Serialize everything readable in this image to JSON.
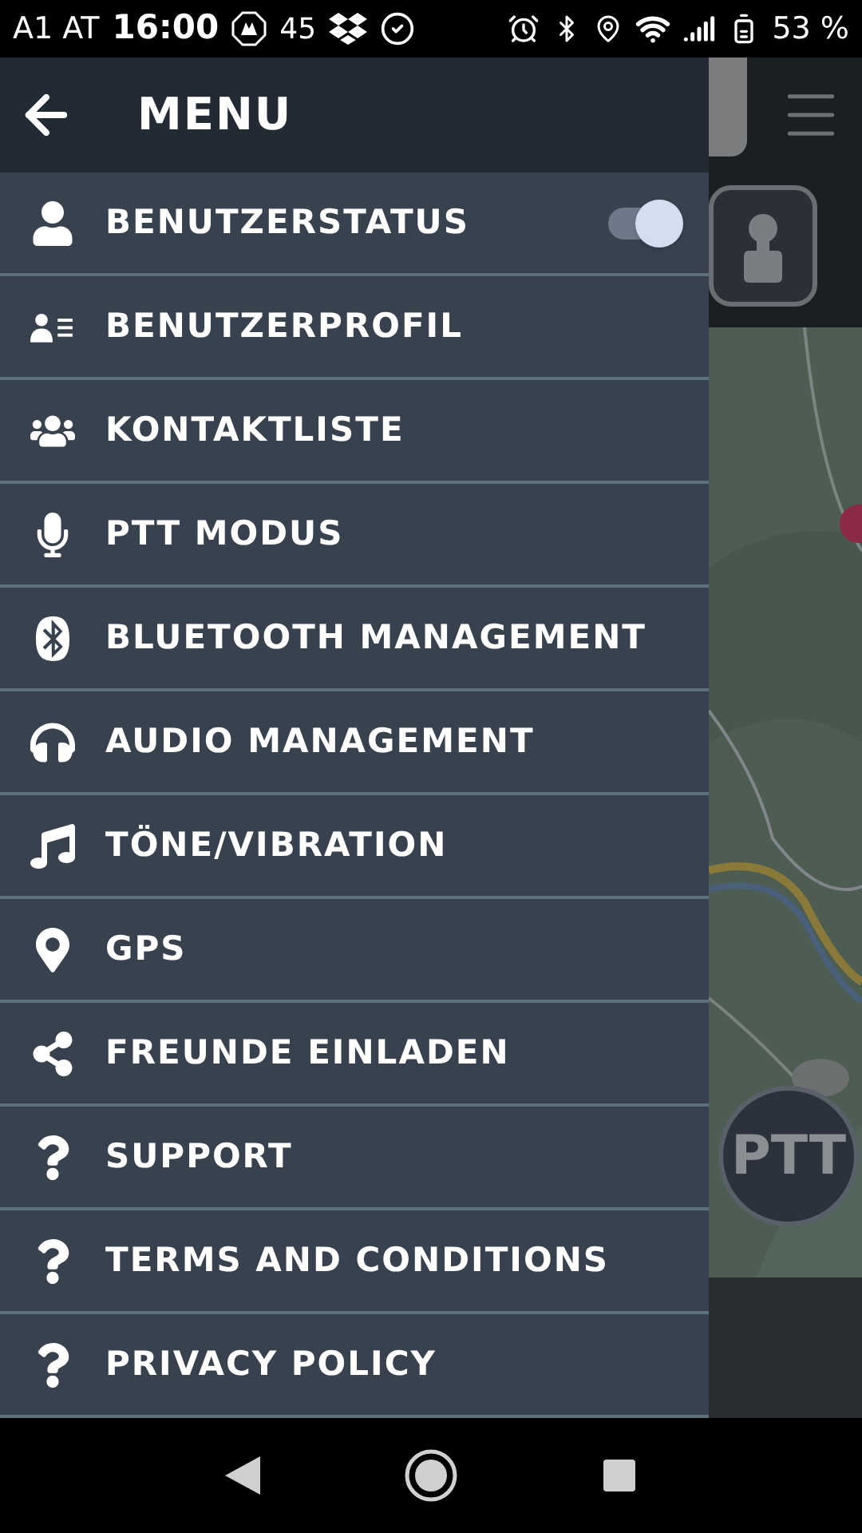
{
  "status_bar": {
    "carrier": "A1 AT",
    "time": "16:00",
    "notification_count": "45",
    "battery": "53 %"
  },
  "drawer": {
    "title": "MENU",
    "items": [
      {
        "label": "BENUTZERSTATUS",
        "kind": "toggle",
        "on": true
      },
      {
        "label": "BENUTZERPROFIL",
        "kind": "link"
      },
      {
        "label": "KONTAKTLISTE",
        "kind": "link"
      },
      {
        "label": "PTT MODUS",
        "kind": "link"
      },
      {
        "label": "BLUETOOTH MANAGEMENT",
        "kind": "link"
      },
      {
        "label": "AUDIO MANAGEMENT",
        "kind": "link"
      },
      {
        "label": "TÖNE/VIBRATION",
        "kind": "link"
      },
      {
        "label": "GPS",
        "kind": "link"
      },
      {
        "label": "FREUNDE EINLADEN",
        "kind": "link"
      },
      {
        "label": "SUPPORT",
        "kind": "link"
      },
      {
        "label": "TERMS AND CONDITIONS",
        "kind": "link"
      },
      {
        "label": "PRIVACY POLICY",
        "kind": "link"
      }
    ]
  },
  "background": {
    "ptt_button": "PTT"
  }
}
